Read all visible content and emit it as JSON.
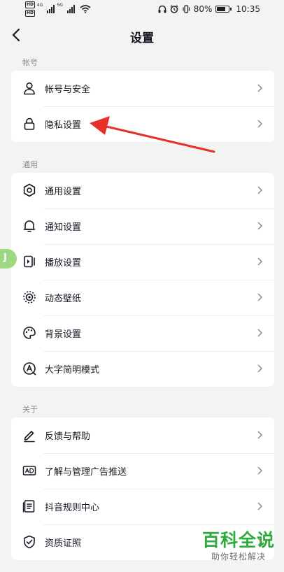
{
  "status_bar": {
    "hd1": "HD",
    "hd2": "HD",
    "net1": "4G",
    "net2": "5G",
    "battery_level": 0.8,
    "battery": "80%",
    "time": "10:35"
  },
  "header": {
    "title": "设置"
  },
  "sections": [
    {
      "label": "帐号",
      "items": [
        {
          "label": "帐号与安全",
          "icon": "user-icon"
        },
        {
          "label": "隐私设置",
          "icon": "lock-icon"
        }
      ]
    },
    {
      "label": "通用",
      "items": [
        {
          "label": "通用设置",
          "icon": "gear-icon"
        },
        {
          "label": "通知设置",
          "icon": "bell-icon"
        },
        {
          "label": "播放设置",
          "icon": "play-icon"
        },
        {
          "label": "动态壁纸",
          "icon": "live-wallpaper-icon"
        },
        {
          "label": "背景设置",
          "icon": "palette-icon"
        },
        {
          "label": "大字简明模式",
          "icon": "large-font-icon"
        }
      ]
    },
    {
      "label": "关于",
      "items": [
        {
          "label": "反馈与帮助",
          "icon": "pen-icon"
        },
        {
          "label": "了解与管理广告推送",
          "icon": "ad-icon"
        },
        {
          "label": "抖音规则中心",
          "icon": "rules-book-icon"
        },
        {
          "label": "资质证照",
          "icon": "shield-check-icon"
        }
      ]
    }
  ],
  "side_handle": {
    "label": "J"
  },
  "watermark": {
    "title": "百科全说",
    "subtitle": "助你轻松解决"
  },
  "colors": {
    "background": "#f3f3f4",
    "card": "#ffffff",
    "annotation_arrow": "#e8302a",
    "watermark": "#2eab3c"
  }
}
